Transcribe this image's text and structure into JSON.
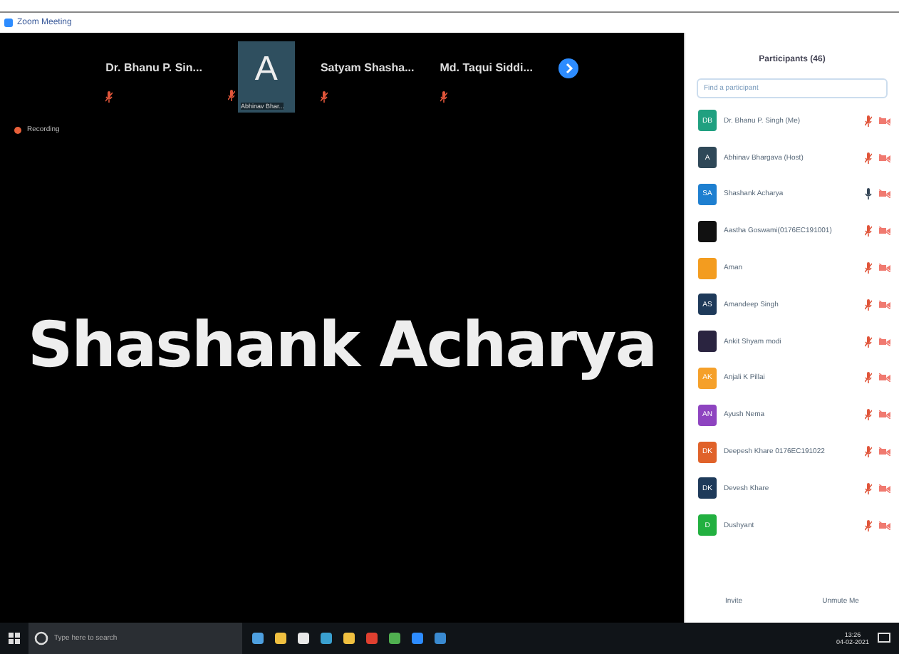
{
  "window": {
    "title": "Zoom Meeting"
  },
  "video_strip": [
    {
      "kind": "name",
      "name": "Dr. Bhanu P. Sin...",
      "muted": true
    },
    {
      "kind": "avatar",
      "initial": "A",
      "name": "Abhinav Bhar...",
      "muted": true
    },
    {
      "kind": "name",
      "name": "Satyam  Shasha...",
      "muted": true
    },
    {
      "kind": "name",
      "name": "Md. Taqui Siddi...",
      "muted": true
    }
  ],
  "recording": {
    "label": "Recording"
  },
  "active_speaker": "Shashank Acharya",
  "participants_panel": {
    "title": "Participants (46)",
    "search": {
      "placeholder": "Find a participant"
    },
    "participants": [
      {
        "name": "Dr. Bhanu P. Singh (Me)",
        "initials": "DB",
        "color": "#20a080",
        "muted": true,
        "video_off": true
      },
      {
        "name": "Abhinav Bhargava (Host)",
        "initials": "A",
        "color": "#2f4858",
        "muted": true,
        "video_off": true
      },
      {
        "name": "Shashank Acharya",
        "initials": "SA",
        "color": "#1e7fd0",
        "muted": false,
        "video_off": true
      },
      {
        "name": "Aastha Goswami(0176EC191001)",
        "color": "#111111",
        "muted": true,
        "video_off": true
      },
      {
        "name": "Aman",
        "color": "#f39c1f",
        "muted": true,
        "video_off": true
      },
      {
        "name": "Amandeep Singh",
        "initials": "AS",
        "color": "#1e3a5a",
        "muted": true,
        "video_off": true
      },
      {
        "name": "Ankit Shyam modi",
        "color": "#2a2440",
        "muted": true,
        "video_off": true
      },
      {
        "name": "Anjali K Pillai",
        "initials": "AK",
        "color": "#f5a02a",
        "muted": true,
        "video_off": true
      },
      {
        "name": "Ayush Nema",
        "initials": "AN",
        "color": "#8e44c0",
        "muted": true,
        "video_off": true
      },
      {
        "name": "Deepesh Khare 0176EC191022",
        "initials": "DK",
        "color": "#e0622a",
        "muted": true,
        "video_off": true
      },
      {
        "name": "Devesh Khare",
        "initials": "DK",
        "color": "#1e3a5a",
        "muted": true,
        "video_off": true
      },
      {
        "name": "Dushyant",
        "initials": "D",
        "color": "#22b040",
        "muted": true,
        "video_off": true
      }
    ],
    "buttons": [
      "Invite",
      "Unmute Me"
    ]
  },
  "taskbar": {
    "search_placeholder": "Type here to search",
    "time": "13:26",
    "date": "04-02-2021"
  }
}
